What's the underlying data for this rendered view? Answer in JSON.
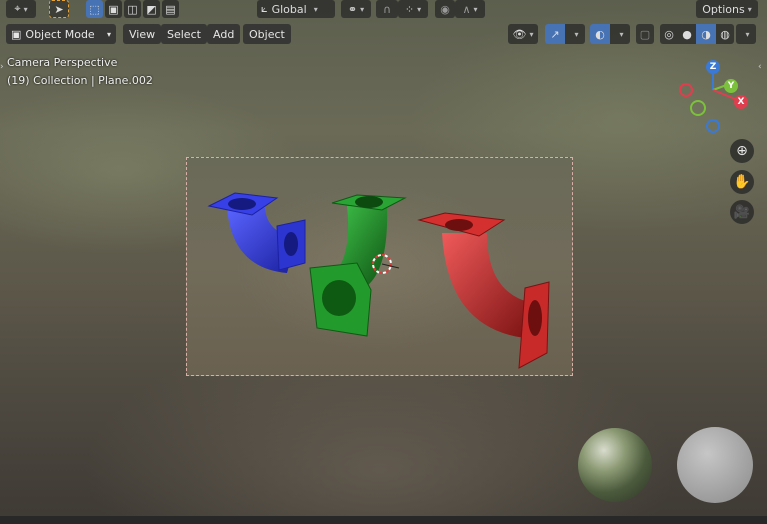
{
  "toolbar": {
    "transform_orientation": "Global",
    "options_label": "Options"
  },
  "header": {
    "mode_label": "Object Mode",
    "menus": [
      "View",
      "Select",
      "Add",
      "Object"
    ]
  },
  "overlay_info": {
    "line1": "Camera Perspective",
    "line2": "(19) Collection | Plane.002"
  },
  "gizmo": {
    "x_label": "X",
    "y_label": "Y",
    "z_label": "Z",
    "colors": {
      "x": "#e03e4f",
      "y": "#7cc13c",
      "z": "#3a7ad6"
    }
  },
  "objects": [
    {
      "name": "blue-pipe",
      "color": "#2b34d6"
    },
    {
      "name": "green-pipe",
      "color": "#1f8a23"
    },
    {
      "name": "red-pipe",
      "color": "#c42525"
    }
  ],
  "icons": {
    "zoom": "zoom-icon",
    "hand": "hand-icon",
    "camera": "camera-icon"
  }
}
